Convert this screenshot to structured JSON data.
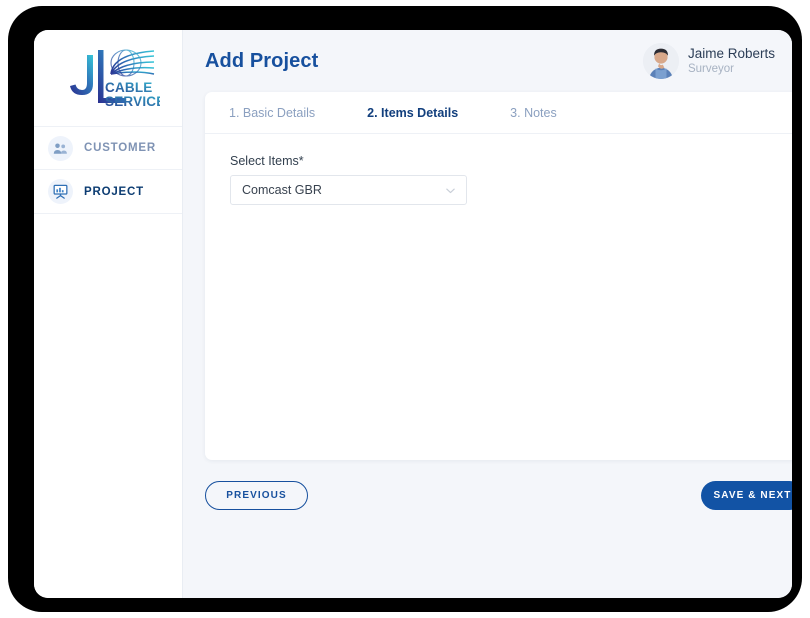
{
  "app": {
    "logo": {
      "monogram": "JL",
      "line1": "CABLE",
      "line2": "SERVICES",
      "icon_name": "cable-fan-logo"
    }
  },
  "sidebar": {
    "items": [
      {
        "label": "CUSTOMER",
        "icon": "people-group-icon",
        "active": false
      },
      {
        "label": "PROJECT",
        "icon": "presentation-board-icon",
        "active": true
      }
    ]
  },
  "header": {
    "title": "Add Project",
    "user": {
      "name": "Jaime Roberts",
      "role": "Surveyor",
      "avatar_icon": "user-photo-avatar"
    }
  },
  "form": {
    "tabs": [
      {
        "label": "1. Basic Details",
        "active": false
      },
      {
        "label": "2. Items Details",
        "active": true
      },
      {
        "label": "3. Notes",
        "active": false
      }
    ],
    "select_items": {
      "label": "Select Items*",
      "value": "Comcast GBR",
      "placeholder": "Select Items",
      "chevron_icon": "chevron-down-icon"
    }
  },
  "actions": {
    "previous_label": "PREVIOUS",
    "save_next_label": "SAVE & NEXT"
  },
  "colors": {
    "brand_blue": "#17509e",
    "active_navy": "#0c3c72",
    "muted_blue": "#8ba0c0",
    "page_bg": "#f4f6fa",
    "primary_button": "#1253a5"
  }
}
